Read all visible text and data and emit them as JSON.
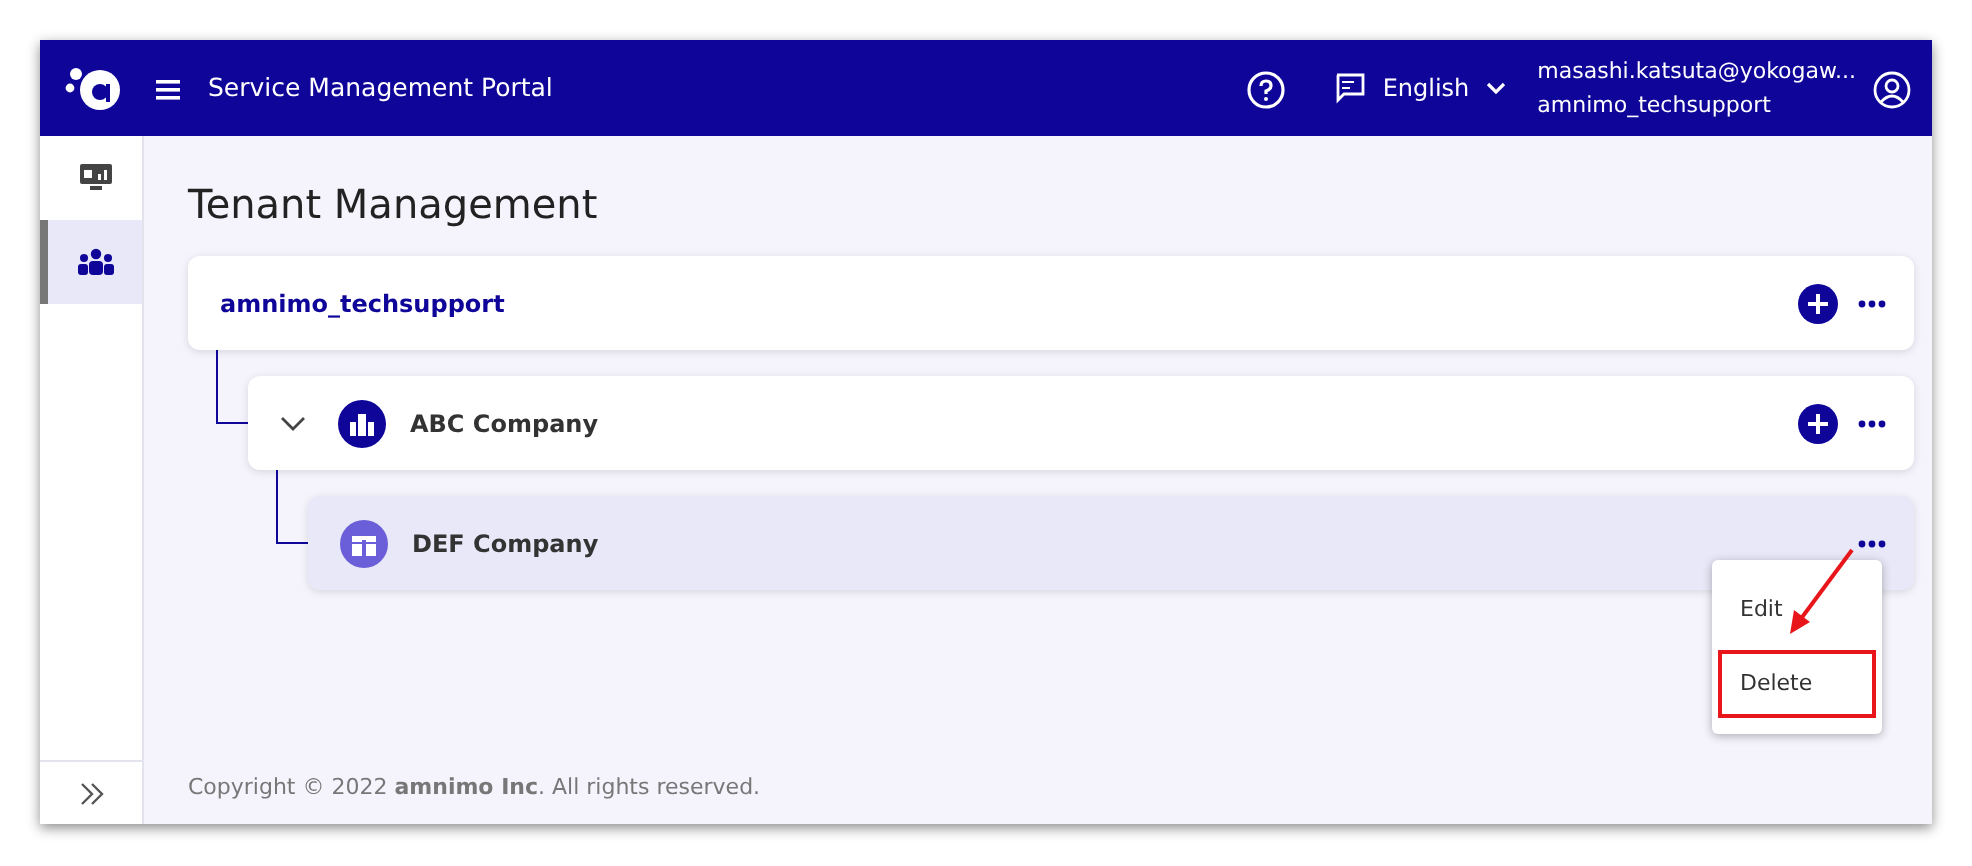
{
  "header": {
    "title": "Service Management Portal",
    "language": "English",
    "user_email": "masashi.katsuta@yokogaw...",
    "user_tenant": "amnimo_techsupport"
  },
  "sidebar": {
    "items": [
      {
        "kind": "monitor",
        "selected": false
      },
      {
        "kind": "users",
        "selected": true
      }
    ]
  },
  "page_title": "Tenant Management",
  "tree": [
    {
      "name": "amnimo_techsupport",
      "kind": "root",
      "selected": false,
      "can_add": true,
      "children": [
        {
          "name": "ABC Company",
          "kind": "company",
          "selected": false,
          "can_add": true,
          "expanded": true,
          "children": [
            {
              "name": "DEF Company",
              "kind": "branch",
              "selected": true,
              "can_add": false,
              "menu": {
                "items": [
                  {
                    "label": "Edit",
                    "highlighted": false
                  },
                  {
                    "label": "Delete",
                    "highlighted": true
                  }
                ]
              }
            }
          ]
        }
      ]
    }
  ],
  "footer": "Copyright © 2022 **amnimo Inc**. All rights reserved."
}
